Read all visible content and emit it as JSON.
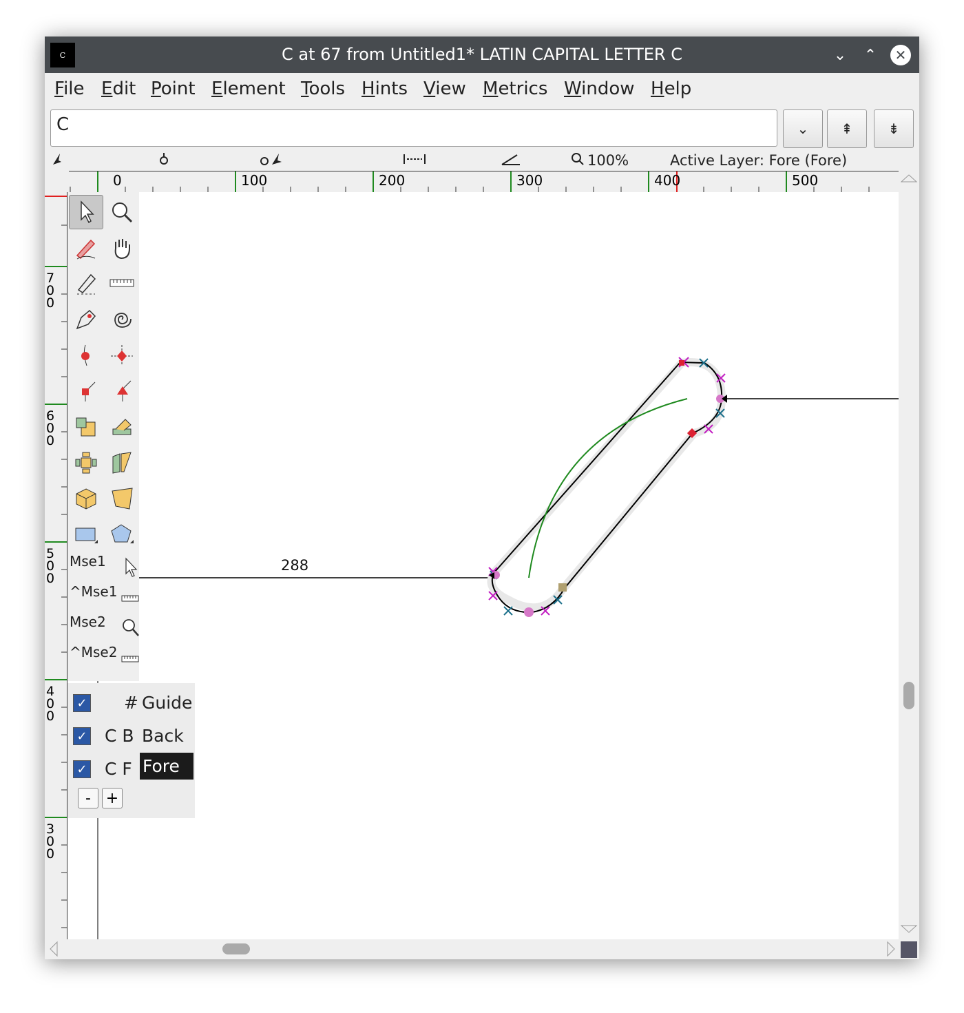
{
  "window": {
    "app_icon_letter": "C",
    "title": "C at 67 from Untitled1* LATIN CAPITAL LETTER C",
    "minimize_glyph": "⌄",
    "maximize_glyph": "⌃",
    "close_glyph": "✕"
  },
  "menu": {
    "file": {
      "u": "F",
      "rest": "ile"
    },
    "edit": {
      "u": "E",
      "rest": "dit"
    },
    "point": {
      "u": "P",
      "rest": "oint"
    },
    "element": {
      "u": "E",
      "rest": "lement"
    },
    "tools": {
      "u": "T",
      "rest": "ools"
    },
    "hints": {
      "u": "H",
      "rest": "ints"
    },
    "view": {
      "u": "V",
      "rest": "iew"
    },
    "metrics": {
      "u": "M",
      "rest": "etrics"
    },
    "window": {
      "u": "W",
      "rest": "indow"
    },
    "help": {
      "u": "H",
      "rest": "elp"
    }
  },
  "glyph_field": {
    "value": "C"
  },
  "toolbar_buttons": {
    "dropdown": "⌄",
    "prev": "⇞",
    "next": "⇟"
  },
  "infobar": {
    "zoom": "100%",
    "active_layer": "Active Layer: Fore (Fore)"
  },
  "rulers": {
    "h_labels": [
      "0",
      "100",
      "200",
      "300",
      "400",
      "500"
    ],
    "v_labels": [
      "7\n0\n0",
      "6\n0\n0",
      "5\n0\n0",
      "4\n0\n0",
      "3\n0\n0"
    ]
  },
  "mouse_bindings": {
    "mse1": "Mse1",
    "ctrl_mse1": "^Mse1",
    "mse2": "Mse2",
    "ctrl_mse2": "^Mse2"
  },
  "measurement": {
    "value": "288"
  },
  "layers": {
    "guide": {
      "mark": "#",
      "name": "Guide",
      "checked": true
    },
    "back": {
      "mark": "C B",
      "name": "Back",
      "checked": true
    },
    "fore": {
      "mark": "C F",
      "name": "Fore",
      "checked": true
    },
    "minus": "-",
    "plus": "+"
  },
  "colors": {
    "titlebar": "#474b4f",
    "guide_green": "#1f8a1f",
    "control_magenta": "#c21fc2",
    "control_teal": "#1a6f8a",
    "layer_active": "#1b1b1b"
  }
}
